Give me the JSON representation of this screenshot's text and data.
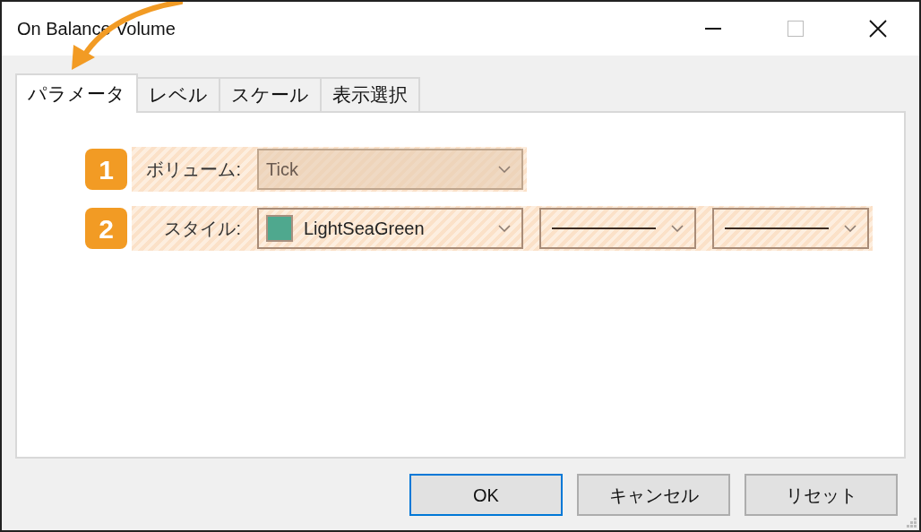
{
  "window": {
    "title": "On Balance Volume"
  },
  "tabs": [
    {
      "label": "パラメータ",
      "selected": true
    },
    {
      "label": "レベル",
      "selected": false
    },
    {
      "label": "スケール",
      "selected": false
    },
    {
      "label": "表示選択",
      "selected": false
    }
  ],
  "rows": [
    {
      "number": "1",
      "label": "ボリューム:",
      "fields": [
        {
          "kind": "text",
          "value": "Tick",
          "disabled": true
        }
      ]
    },
    {
      "number": "2",
      "label": "スタイル:",
      "fields": [
        {
          "kind": "color",
          "value": "LightSeaGreen",
          "color": "#4fa88e",
          "disabled": false
        },
        {
          "kind": "line",
          "disabled": false
        },
        {
          "kind": "line",
          "disabled": false
        }
      ]
    }
  ],
  "buttons": [
    {
      "label": "OK",
      "default": true
    },
    {
      "label": "キャンセル",
      "default": false
    },
    {
      "label": "リセット",
      "default": false
    }
  ]
}
